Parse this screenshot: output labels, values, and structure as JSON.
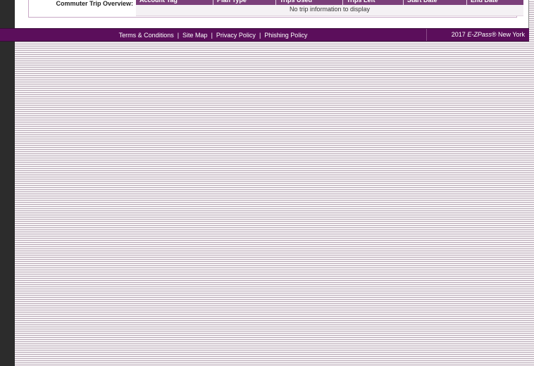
{
  "trip_overview": {
    "label": "Commuter Trip Overview:",
    "columns": [
      "Account Tag",
      "Plan Type",
      "Trips Used",
      "Trips Left",
      "Start Date",
      "End Date"
    ],
    "empty_message": "No trip information to display"
  },
  "footer": {
    "links": [
      "Terms & Conditions",
      "Site Map",
      "Privacy Policy",
      "Phishing Policy"
    ],
    "separator": "|",
    "copyright_year": "2017",
    "copyright_brand": "E-ZPass",
    "copyright_rest": "® New York"
  },
  "colors": {
    "footer_bg": "#5b0e5b",
    "table_header_bg": "#7b3f7a",
    "left_rail": "#2c2c2c"
  }
}
